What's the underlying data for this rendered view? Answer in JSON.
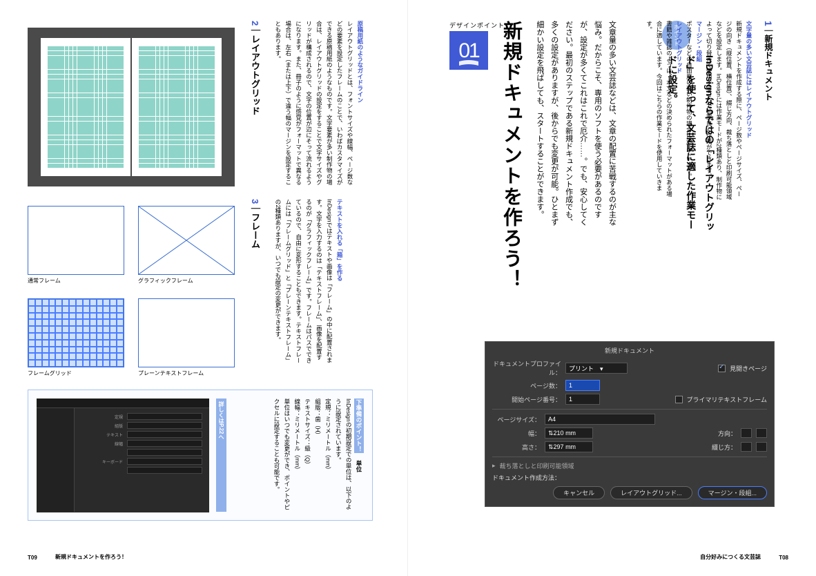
{
  "right": {
    "section_label": "デザインポイント",
    "big_title": "新規ドキュメントを作ろう！",
    "intro": "文章量の多い文芸誌などは、文章の配置に苦戦するのが主な悩み。だからこそ、専用のソフトを使う必要があるのですが、設定が多くてこれはこれで厄介……。でも、安心してください。最初のステップである新規ドキュメント作成でも、多くの設定がありますが、後からでも変更が可能。ひとまず細かい設定を飛ばしても、スタートすることができます。",
    "point_label": "ポイント",
    "point_headline": "InDesignならではの「レイアウトグリッド」を使って、文芸誌に適した作業モードに設定。",
    "sec1_num": "1",
    "sec1_title": "新規ドキュメント",
    "sec1_hd1": "文字量の多い文芸誌にはレイアウトグリッド",
    "sec1_p1": "新規ドキュメントを作成する際に、ページ数やページサイズ、ページの向き（縦位置、横位置）、綴じ方向、裁ち落としと印刷可能領域などを設定します。InDesignには作業モードが2種類あり、制作物によって切り替えて使用することで効率良く作業ができます。",
    "sec1_hd2": "マージン・段組",
    "sec1_p2": "ポスターなどの自由度の高い制作物の場合に適しています。",
    "sec1_hd3": "レイアウトグリッド",
    "sec1_p3": "書籍や雑誌のように、本文などの決められたフォーマットがある場合に適しています。今回はこちらの作業モードを使用していきます。",
    "dialog": {
      "title": "新規ドキュメント",
      "profile_label": "ドキュメントプロファイル：",
      "profile_value": "プリント",
      "facing_label": "見開きページ",
      "pages_label": "ページ数：",
      "pages_value": "1",
      "start_label": "開始ページ番号：",
      "start_value": "1",
      "primary_label": "プライマリテキストフレーム",
      "size_label": "ページサイズ：",
      "size_value": "A4",
      "width_label": "幅：",
      "width_value": "210 mm",
      "height_label": "高さ：",
      "height_value": "297 mm",
      "orient_label": "方向：",
      "bind_label": "綴じ方：",
      "bleed_label": "裁ち落としと印刷可能領域",
      "method_label": "ドキュメント作成方法：",
      "btn_cancel": "キャンセル",
      "btn_grid": "レイアウトグリッド...",
      "btn_margin": "マージン・段組..."
    },
    "page_num": "T08",
    "footer": "自分好みにつくる文芸誌"
  },
  "left": {
    "sec2_num": "2",
    "sec2_title": "レイアウトグリッド",
    "sec2_hd": "原稿用紙のようなガイドライン",
    "sec2_p": "レイアウトグリッドとは、フォントサイズや線幅、ページ数などの要素を設定したフレームのことで、いわばカスタマイズができる原稿用紙のようなものです。文字要素が多い制作物の場合は、レイアウトグリッドの設定をすることで文字サイズやグリッドが構成されるので、文字の位置が辺にそって流れるようになります。また、冊子のように感覚がフォーマットで異なる場合は、左右（または上下）で違う幅のマージンを設定することもあります。",
    "sec3_num": "3",
    "sec3_title": "フレーム",
    "sec3_hd": "テキストを入れる「箱」を作る",
    "sec3_p": "InDesignではテキストや画像は「フレーム」の中に配置されます。文字を入力するのは「テキストフレーム」、画像を配置するのが「グラフィックフレーム」です。フレームはパスでできているので、自由に変形することもできます。テキストフレームには「フレームグリッド」と「プレーンテキストフレーム」の2種類ありますが、いつでも設定の変更ができます。",
    "frame_labels": [
      "通常フレーム",
      "グラフィックフレーム",
      "フレームグリッド",
      "プレーンテキストフレーム"
    ],
    "callout": {
      "tag": "下準備のポイント！",
      "link": "詳しくはP.22へ",
      "title": "単位",
      "p": "InDesignの初期設定での単位は、以下のように設定されています。",
      "rows": [
        "定規：ミリメートル（mm）",
        "組版：歯（H）",
        "テキストサイズ：級（Q）",
        "線幅：ミリメートル（mm）"
      ],
      "p2": "単位はいつでも変更ができ、ポイントやピクセルに設定することも可能です。"
    },
    "page_num": "T09",
    "footer": "新規ドキュメントを作ろう！"
  }
}
